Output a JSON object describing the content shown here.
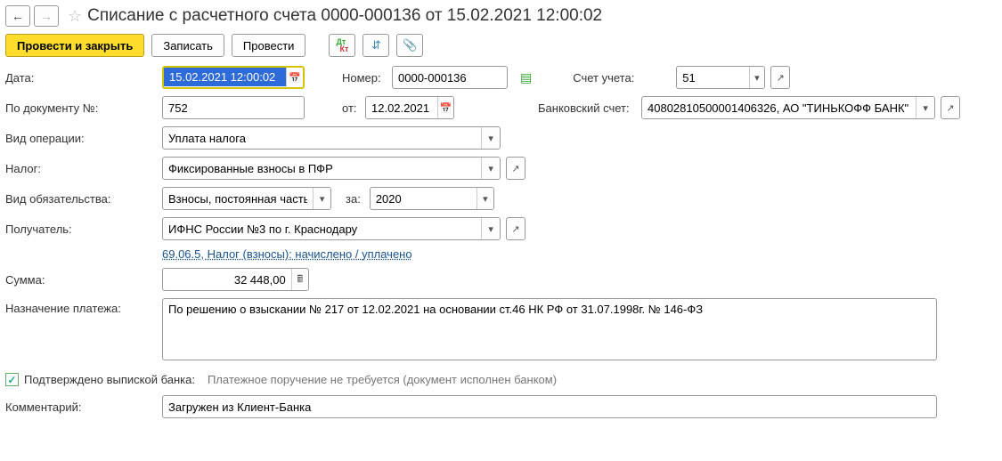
{
  "header": {
    "title": "Списание с расчетного счета 0000-000136 от 15.02.2021 12:00:02"
  },
  "toolbar": {
    "post_close": "Провести и закрыть",
    "save": "Записать",
    "post": "Провести"
  },
  "fields": {
    "date_label": "Дата:",
    "date_value": "15.02.2021 12:00:02",
    "number_label": "Номер:",
    "number_value": "0000-000136",
    "account_label": "Счет учета:",
    "account_value": "51",
    "doc_no_label": "По документу №:",
    "doc_no_value": "752",
    "doc_from_label": "от:",
    "doc_from_value": "12.02.2021",
    "bank_acc_label": "Банковский счет:",
    "bank_acc_value": "40802810500001406326, АО \"ТИНЬКОФФ БАНК\"",
    "op_type_label": "Вид операции:",
    "op_type_value": "Уплата налога",
    "tax_label": "Налог:",
    "tax_value": "Фиксированные взносы в ПФР",
    "obl_label": "Вид обязательства:",
    "obl_value": "Взносы, постоянная часть",
    "period_label": "за:",
    "period_value": "2020",
    "recipient_label": "Получатель:",
    "recipient_value": "ИФНС России №3 по г. Краснодару",
    "kbk_link": "69.06.5, Налог (взносы): начислено / уплачено",
    "sum_label": "Сумма:",
    "sum_value": "32 448,00",
    "purpose_label": "Назначение платежа:",
    "purpose_value": "По решению о взыскании № 217 от 12.02.2021 на основании ст.46 НК РФ от 31.07.1998г. № 146-ФЗ",
    "confirmed_label": "Подтверждено выпиской банка:",
    "confirmed_note": "Платежное поручение не требуется (документ исполнен банком)",
    "comment_label": "Комментарий:",
    "comment_value": "Загружен из Клиент-Банка"
  }
}
